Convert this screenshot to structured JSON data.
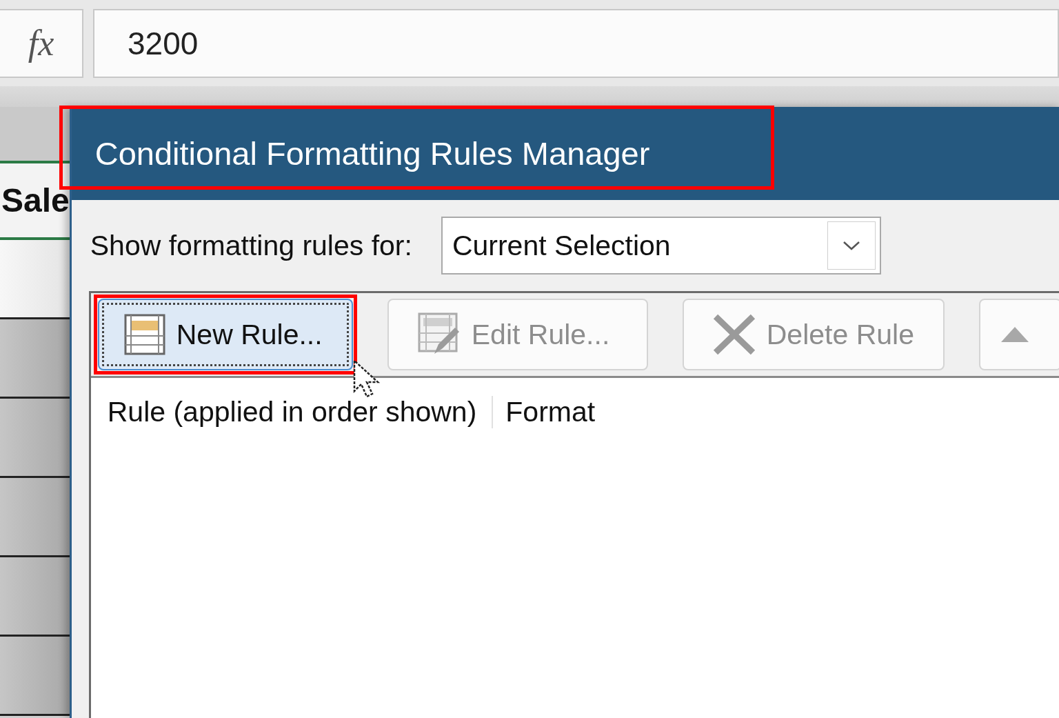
{
  "formula_bar": {
    "function_label": "fx",
    "value": "3200"
  },
  "sheet": {
    "cell_text": "Sale"
  },
  "dialog": {
    "title": "Conditional Formatting Rules Manager",
    "title_highlighted": true,
    "scope_label": {
      "text": "Show formatting rules for:"
    },
    "scope_dropdown": {
      "value": "Current Selection"
    },
    "toolbar": [
      {
        "kind": "new",
        "label": "New Rule...",
        "disabled": false,
        "focused": true,
        "highlighted": true
      },
      {
        "kind": "edit",
        "label": "Edit Rule...",
        "disabled": true,
        "focused": false,
        "highlighted": false
      },
      {
        "kind": "delete",
        "label": "Delete Rule",
        "disabled": true,
        "focused": false,
        "highlighted": false
      },
      {
        "kind": "move_up",
        "disabled": true,
        "focused": false,
        "highlighted": false
      }
    ],
    "columns": [
      "Rule (applied in order shown)",
      "Format"
    ]
  }
}
